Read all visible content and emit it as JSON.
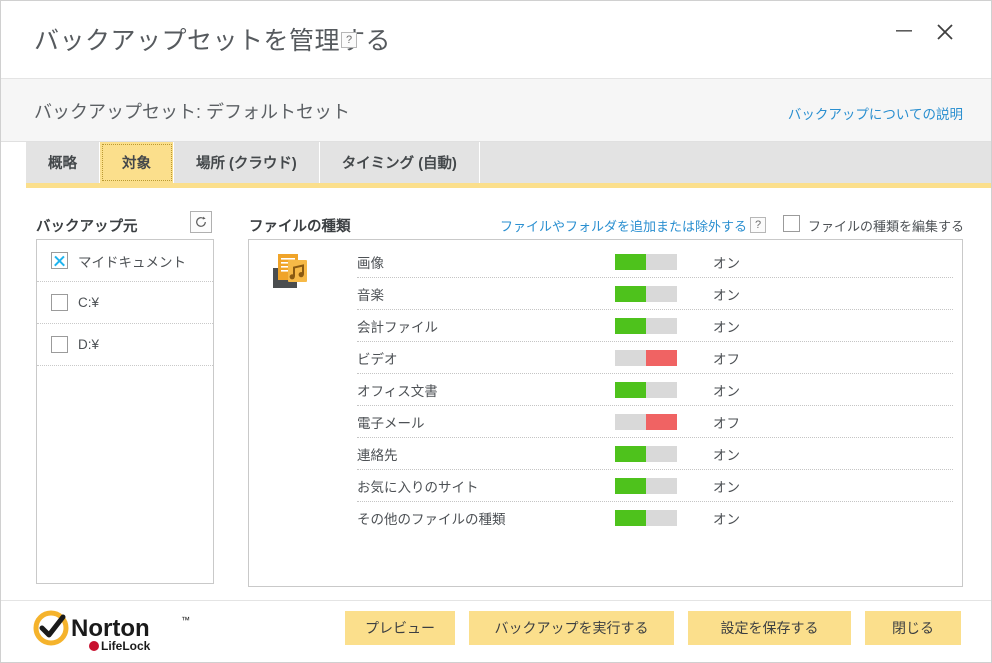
{
  "window": {
    "title": "バックアップセットを管理する",
    "help_symbol": "?",
    "minimize_label": "minimize",
    "close_label": "close"
  },
  "subheader": {
    "label": "バックアップセット:  デフォルトセット",
    "link": "バックアップについての説明"
  },
  "tabs": [
    {
      "label": "概略",
      "active": false
    },
    {
      "label": "対象",
      "active": true
    },
    {
      "label": "場所 (クラウド)",
      "active": false
    },
    {
      "label": "タイミング (自動)",
      "active": false
    }
  ],
  "source_panel": {
    "title": "バックアップ元",
    "refresh_icon": "refresh-icon",
    "items": [
      {
        "label": "マイドキュメント",
        "checked": true
      },
      {
        "label": "C:¥",
        "checked": false
      },
      {
        "label": "D:¥",
        "checked": false
      }
    ]
  },
  "filetypes_panel": {
    "title": "ファイルの種類",
    "add_exclude_link": "ファイルやフォルダを追加または除外する",
    "help_symbol": "?",
    "edit_checkbox_label": "ファイルの種類を編集する",
    "edit_checkbox_checked": false,
    "icon": "documents-music-icon",
    "rows": [
      {
        "name": "画像",
        "state": "オン",
        "on": true
      },
      {
        "name": "音楽",
        "state": "オン",
        "on": true
      },
      {
        "name": "会計ファイル",
        "state": "オン",
        "on": true
      },
      {
        "name": "ビデオ",
        "state": "オフ",
        "on": false
      },
      {
        "name": "オフィス文書",
        "state": "オン",
        "on": true
      },
      {
        "name": "電子メール",
        "state": "オフ",
        "on": false
      },
      {
        "name": "連絡先",
        "state": "オン",
        "on": true
      },
      {
        "name": "お気に入りのサイト",
        "state": "オン",
        "on": true
      },
      {
        "name": "その他のファイルの種類",
        "state": "オン",
        "on": true
      }
    ]
  },
  "footer": {
    "logo_primary": "Norton",
    "logo_secondary": "LifeLock",
    "buttons": [
      {
        "label": "プレビュー"
      },
      {
        "label": "バックアップを実行する"
      },
      {
        "label": "設定を保存する"
      },
      {
        "label": "閉じる"
      }
    ]
  },
  "colors": {
    "accent_yellow": "#fbdf8c",
    "link_blue": "#2a8fd0",
    "toggle_on_green": "#4ec21c",
    "toggle_off_red": "#f06363",
    "toggle_track_gray": "#d9d9d9",
    "tabbar_gray": "#e3e3e3",
    "check_blue": "#1fb4ef"
  }
}
